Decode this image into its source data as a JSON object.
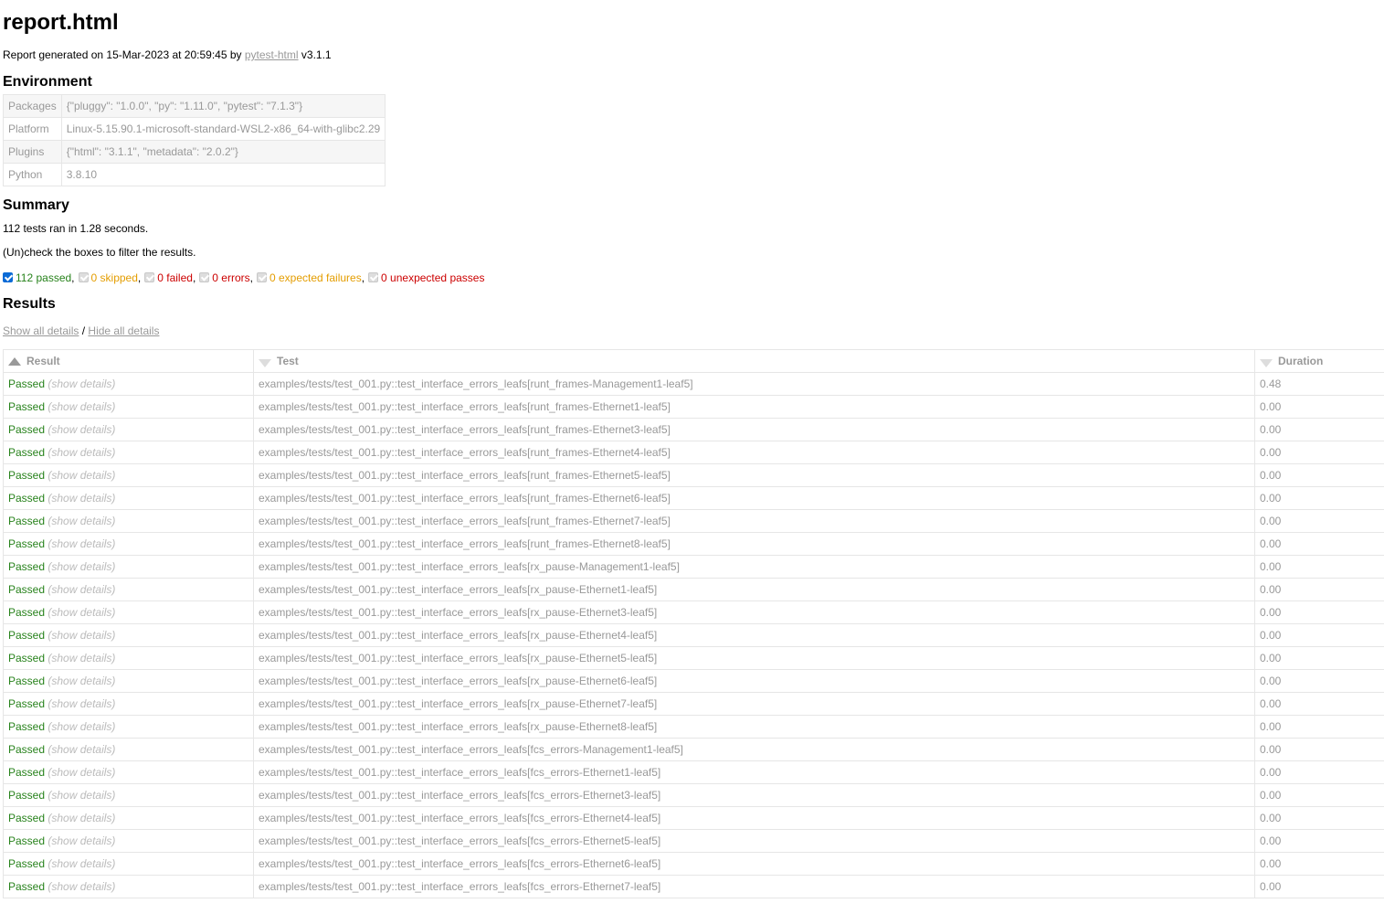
{
  "title": "report.html",
  "generated": {
    "prefix": "Report generated on 15-Mar-2023 at 20:59:45 by",
    "link": "pytest-html",
    "version": "v3.1.1"
  },
  "environment": {
    "heading": "Environment",
    "rows": [
      {
        "key": "Packages",
        "value": "{\"pluggy\": \"1.0.0\", \"py\": \"1.11.0\", \"pytest\": \"7.1.3\"}"
      },
      {
        "key": "Platform",
        "value": "Linux-5.15.90.1-microsoft-standard-WSL2-x86_64-with-glibc2.29"
      },
      {
        "key": "Plugins",
        "value": "{\"html\": \"3.1.1\", \"metadata\": \"2.0.2\"}"
      },
      {
        "key": "Python",
        "value": "3.8.10"
      }
    ]
  },
  "summary": {
    "heading": "Summary",
    "ran": "112 tests ran in 1.28 seconds.",
    "hint": "(Un)check the boxes to filter the results.",
    "filters": [
      {
        "label": "112 passed",
        "cls": "passed",
        "checked": true
      },
      {
        "label": "0 skipped",
        "cls": "skipped",
        "checked": false
      },
      {
        "label": "0 failed",
        "cls": "failed",
        "checked": false
      },
      {
        "label": "0 errors",
        "cls": "error",
        "checked": false
      },
      {
        "label": "0 expected failures",
        "cls": "xfailed",
        "checked": false
      },
      {
        "label": "0 unexpected passes",
        "cls": "xpassed",
        "checked": false
      }
    ]
  },
  "results": {
    "heading": "Results",
    "show_all": "Show all details",
    "separator": " / ",
    "hide_all": "Hide all details",
    "columns": {
      "result": "Result",
      "test": "Test",
      "duration": "Duration"
    },
    "show_details": "(show details)",
    "rows": [
      {
        "result": "Passed",
        "test": "examples/tests/test_001.py::test_interface_errors_leafs[runt_frames-Management1-leaf5]",
        "duration": "0.48"
      },
      {
        "result": "Passed",
        "test": "examples/tests/test_001.py::test_interface_errors_leafs[runt_frames-Ethernet1-leaf5]",
        "duration": "0.00"
      },
      {
        "result": "Passed",
        "test": "examples/tests/test_001.py::test_interface_errors_leafs[runt_frames-Ethernet3-leaf5]",
        "duration": "0.00"
      },
      {
        "result": "Passed",
        "test": "examples/tests/test_001.py::test_interface_errors_leafs[runt_frames-Ethernet4-leaf5]",
        "duration": "0.00"
      },
      {
        "result": "Passed",
        "test": "examples/tests/test_001.py::test_interface_errors_leafs[runt_frames-Ethernet5-leaf5]",
        "duration": "0.00"
      },
      {
        "result": "Passed",
        "test": "examples/tests/test_001.py::test_interface_errors_leafs[runt_frames-Ethernet6-leaf5]",
        "duration": "0.00"
      },
      {
        "result": "Passed",
        "test": "examples/tests/test_001.py::test_interface_errors_leafs[runt_frames-Ethernet7-leaf5]",
        "duration": "0.00"
      },
      {
        "result": "Passed",
        "test": "examples/tests/test_001.py::test_interface_errors_leafs[runt_frames-Ethernet8-leaf5]",
        "duration": "0.00"
      },
      {
        "result": "Passed",
        "test": "examples/tests/test_001.py::test_interface_errors_leafs[rx_pause-Management1-leaf5]",
        "duration": "0.00"
      },
      {
        "result": "Passed",
        "test": "examples/tests/test_001.py::test_interface_errors_leafs[rx_pause-Ethernet1-leaf5]",
        "duration": "0.00"
      },
      {
        "result": "Passed",
        "test": "examples/tests/test_001.py::test_interface_errors_leafs[rx_pause-Ethernet3-leaf5]",
        "duration": "0.00"
      },
      {
        "result": "Passed",
        "test": "examples/tests/test_001.py::test_interface_errors_leafs[rx_pause-Ethernet4-leaf5]",
        "duration": "0.00"
      },
      {
        "result": "Passed",
        "test": "examples/tests/test_001.py::test_interface_errors_leafs[rx_pause-Ethernet5-leaf5]",
        "duration": "0.00"
      },
      {
        "result": "Passed",
        "test": "examples/tests/test_001.py::test_interface_errors_leafs[rx_pause-Ethernet6-leaf5]",
        "duration": "0.00"
      },
      {
        "result": "Passed",
        "test": "examples/tests/test_001.py::test_interface_errors_leafs[rx_pause-Ethernet7-leaf5]",
        "duration": "0.00"
      },
      {
        "result": "Passed",
        "test": "examples/tests/test_001.py::test_interface_errors_leafs[rx_pause-Ethernet8-leaf5]",
        "duration": "0.00"
      },
      {
        "result": "Passed",
        "test": "examples/tests/test_001.py::test_interface_errors_leafs[fcs_errors-Management1-leaf5]",
        "duration": "0.00"
      },
      {
        "result": "Passed",
        "test": "examples/tests/test_001.py::test_interface_errors_leafs[fcs_errors-Ethernet1-leaf5]",
        "duration": "0.00"
      },
      {
        "result": "Passed",
        "test": "examples/tests/test_001.py::test_interface_errors_leafs[fcs_errors-Ethernet3-leaf5]",
        "duration": "0.00"
      },
      {
        "result": "Passed",
        "test": "examples/tests/test_001.py::test_interface_errors_leafs[fcs_errors-Ethernet4-leaf5]",
        "duration": "0.00"
      },
      {
        "result": "Passed",
        "test": "examples/tests/test_001.py::test_interface_errors_leafs[fcs_errors-Ethernet5-leaf5]",
        "duration": "0.00"
      },
      {
        "result": "Passed",
        "test": "examples/tests/test_001.py::test_interface_errors_leafs[fcs_errors-Ethernet6-leaf5]",
        "duration": "0.00"
      },
      {
        "result": "Passed",
        "test": "examples/tests/test_001.py::test_interface_errors_leafs[fcs_errors-Ethernet7-leaf5]",
        "duration": "0.00"
      }
    ]
  }
}
